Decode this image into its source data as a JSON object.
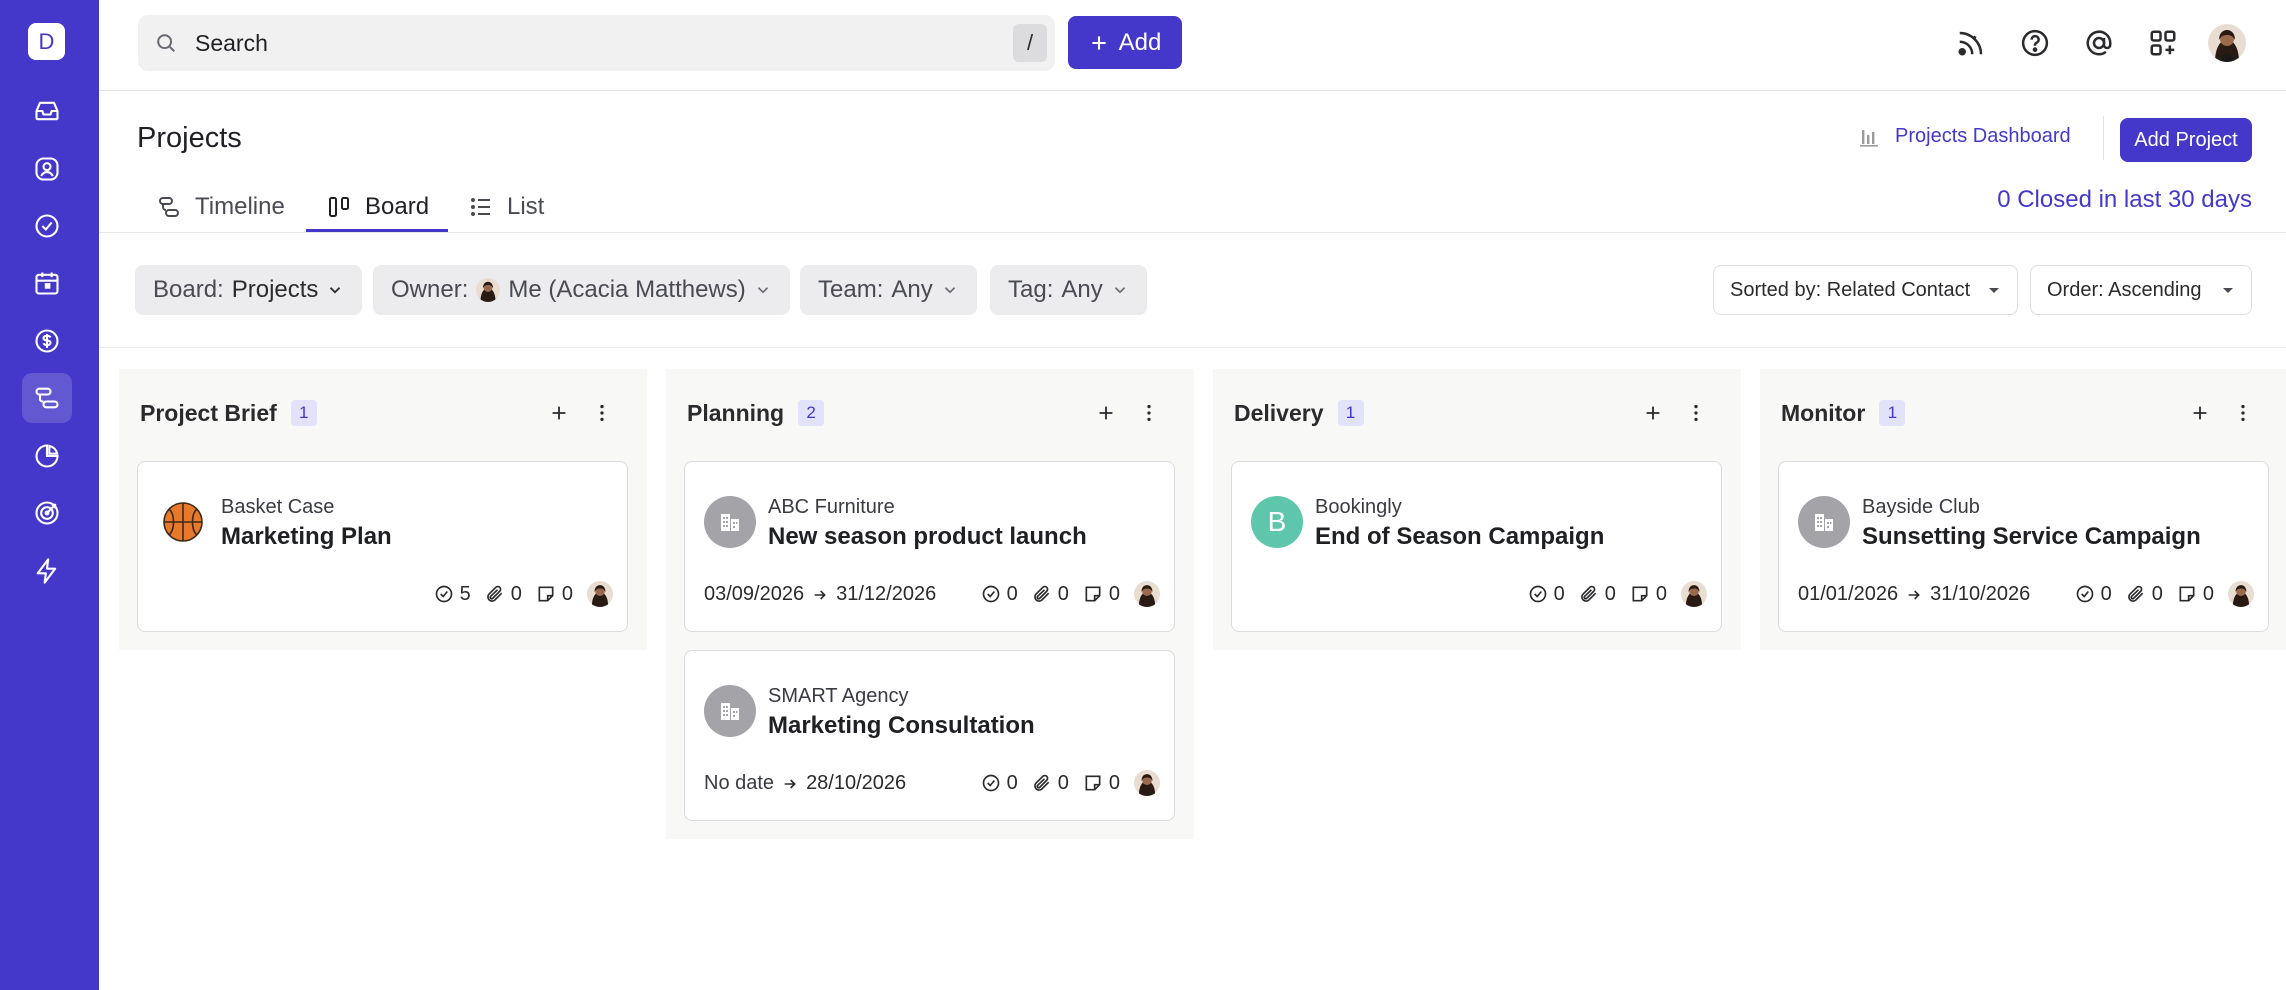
{
  "app": {
    "logo_letter": "D",
    "accent": "#4338ca"
  },
  "sidebar": {
    "items": [
      {
        "icon": "inbox-icon"
      },
      {
        "icon": "contacts-icon"
      },
      {
        "icon": "tasks-icon"
      },
      {
        "icon": "calendar-icon"
      },
      {
        "icon": "dollar-icon"
      },
      {
        "icon": "projects-icon",
        "active": true
      },
      {
        "icon": "reports-icon"
      },
      {
        "icon": "target-icon"
      },
      {
        "icon": "lightning-icon"
      }
    ]
  },
  "topbar": {
    "search_placeholder": "Search",
    "search_shortcut": "/",
    "add_label": "Add",
    "icons": [
      "feed-icon",
      "help-icon",
      "mention-icon",
      "apps-icon"
    ]
  },
  "header": {
    "title": "Projects",
    "dashboard_link": "Projects Dashboard",
    "add_project_label": "Add Project",
    "tabs": [
      {
        "label": "Timeline",
        "icon": "timeline-icon"
      },
      {
        "label": "Board",
        "icon": "board-icon",
        "active": true
      },
      {
        "label": "List",
        "icon": "list-icon"
      }
    ],
    "closed_summary": "0 Closed in last 30 days"
  },
  "filters": {
    "board": {
      "label": "Board:",
      "value": "Projects"
    },
    "owner": {
      "label": "Owner:",
      "value": "Me (Acacia Matthews)"
    },
    "team": {
      "label": "Team:",
      "value": "Any"
    },
    "tag": {
      "label": "Tag:",
      "value": "Any"
    },
    "sort": "Sorted by: Related Contact",
    "order": "Order: Ascending"
  },
  "columns": [
    {
      "title": "Project Brief",
      "count": "1",
      "cards": [
        {
          "company": "Basket Case",
          "name": "Marketing Plan",
          "icon": "basketball-icon",
          "start": "",
          "end": "",
          "tasks": "5",
          "files": "0",
          "notes": "0"
        }
      ]
    },
    {
      "title": "Planning",
      "count": "2",
      "cards": [
        {
          "company": "ABC Furniture",
          "name": "New season product launch",
          "icon": "building-icon",
          "start": "03/09/2026",
          "end": "31/12/2026",
          "tasks": "0",
          "files": "0",
          "notes": "0"
        },
        {
          "company": "SMART Agency",
          "name": "Marketing Consultation",
          "icon": "building-icon",
          "start": "No date",
          "end": "28/10/2026",
          "tasks": "0",
          "files": "0",
          "notes": "0"
        }
      ]
    },
    {
      "title": "Delivery",
      "count": "1",
      "cards": [
        {
          "company": "Bookingly",
          "name": "End of Season Campaign",
          "icon": "letter-avatar",
          "initial": "B",
          "initial_color": "#5ec7ab",
          "start": "",
          "end": "",
          "tasks": "0",
          "files": "0",
          "notes": "0"
        }
      ]
    },
    {
      "title": "Monitor",
      "count": "1",
      "cards": [
        {
          "company": "Bayside Club",
          "name": "Sunsetting Service Campaign",
          "icon": "building-icon",
          "start": "01/01/2026",
          "end": "31/10/2026",
          "tasks": "0",
          "files": "0",
          "notes": "0"
        }
      ]
    }
  ]
}
